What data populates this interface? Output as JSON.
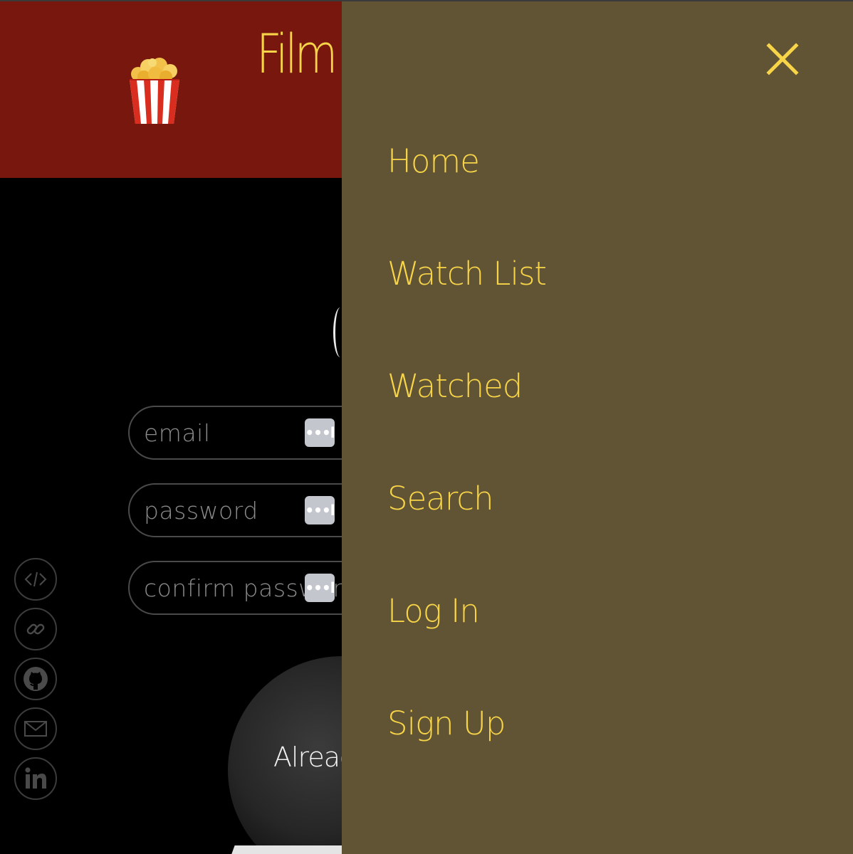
{
  "header": {
    "brand": "Film",
    "logo_icon": "popcorn-icon"
  },
  "form": {
    "fields": [
      {
        "placeholder": "email",
        "value": "",
        "autofill_icon": "password-manager-key-icon",
        "autofill_glyph": "•••l"
      },
      {
        "placeholder": "password",
        "value": "",
        "autofill_icon": "password-manager-key-icon",
        "autofill_glyph": "•••l"
      },
      {
        "placeholder": "confirm password",
        "value": "",
        "autofill_icon": "password-manager-key-icon",
        "autofill_glyph": "•••l"
      }
    ],
    "already_text": "Alreac"
  },
  "social": [
    {
      "icon": "code-icon"
    },
    {
      "icon": "link-icon"
    },
    {
      "icon": "github-icon"
    },
    {
      "icon": "email-icon"
    },
    {
      "icon": "linkedin-icon"
    }
  ],
  "drawer": {
    "close_icon": "close-icon",
    "items": [
      {
        "label": "Home"
      },
      {
        "label": "Watch List"
      },
      {
        "label": "Watched"
      },
      {
        "label": "Search"
      },
      {
        "label": "Log In"
      },
      {
        "label": "Sign Up"
      }
    ]
  },
  "colors": {
    "header_bg": "#77170d",
    "drawer_bg": "#615435",
    "accent_yellow": "#f8d548",
    "page_bg": "#000000"
  }
}
